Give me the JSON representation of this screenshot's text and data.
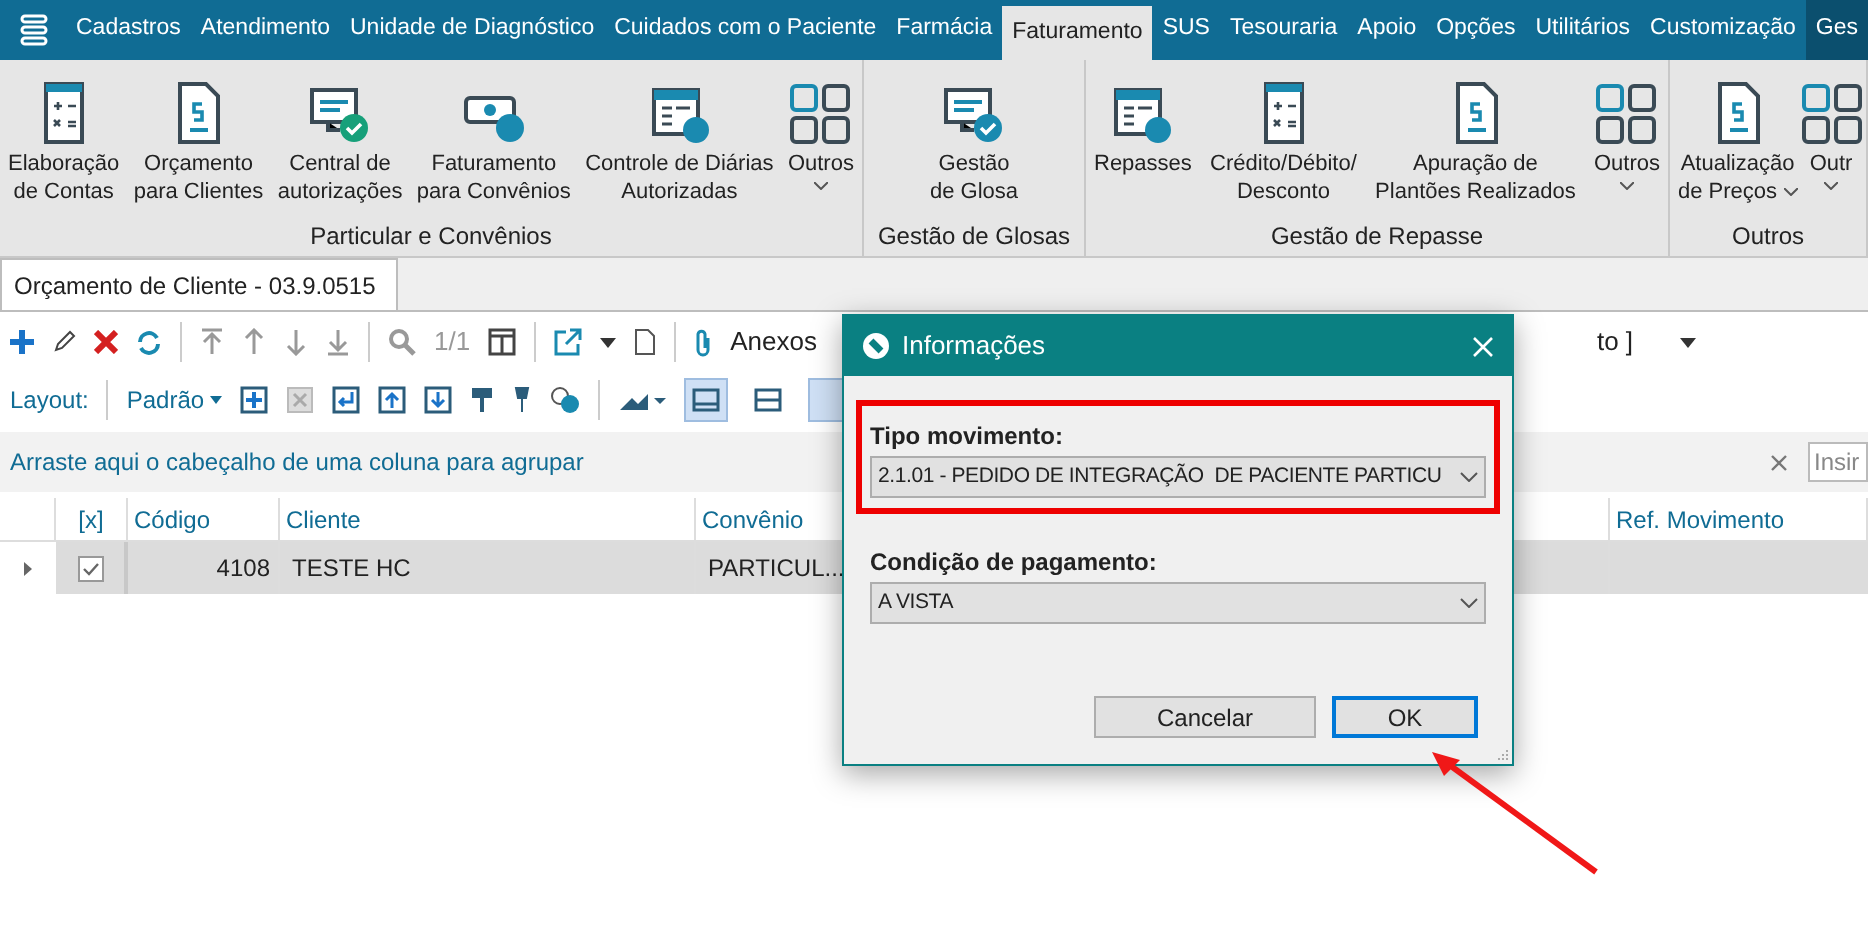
{
  "menu_bar": {
    "items": [
      {
        "label": "Cadastros",
        "selected": false,
        "contextual": false
      },
      {
        "label": "Atendimento",
        "selected": false,
        "contextual": false
      },
      {
        "label": "Unidade de Diagnóstico",
        "selected": false,
        "contextual": false
      },
      {
        "label": "Cuidados com o Paciente",
        "selected": false,
        "contextual": false
      },
      {
        "label": "Farmácia",
        "selected": false,
        "contextual": false
      },
      {
        "label": "Faturamento",
        "selected": true,
        "contextual": false
      },
      {
        "label": "SUS",
        "selected": false,
        "contextual": false
      },
      {
        "label": "Tesouraria",
        "selected": false,
        "contextual": false
      },
      {
        "label": "Apoio",
        "selected": false,
        "contextual": false
      },
      {
        "label": "Opções",
        "selected": false,
        "contextual": false
      },
      {
        "label": "Utilitários",
        "selected": false,
        "contextual": false
      },
      {
        "label": "Customização",
        "selected": false,
        "contextual": false
      },
      {
        "label": "Ges",
        "selected": false,
        "contextual": true
      }
    ]
  },
  "ribbon": {
    "groups": [
      {
        "title": "Particular e Convênios",
        "buttons": [
          {
            "kind": "command",
            "lines": [
              "Elaboração",
              "de Contas"
            ],
            "dropdown": false
          },
          {
            "kind": "command",
            "lines": [
              "Orçamento",
              "para Clientes"
            ],
            "dropdown": false
          },
          {
            "kind": "command",
            "lines": [
              "Central de",
              "autorizações"
            ],
            "dropdown": false
          },
          {
            "kind": "command",
            "lines": [
              "Faturamento",
              "para Convênios"
            ],
            "dropdown": false
          },
          {
            "kind": "command",
            "lines": [
              "Controle de Diárias",
              "Autorizadas"
            ],
            "dropdown": false
          },
          {
            "kind": "more",
            "lines": [
              "Outros"
            ],
            "dropdown": true
          }
        ]
      },
      {
        "title": "Gestão de Glosas",
        "buttons": [
          {
            "kind": "command",
            "lines": [
              "Gestão",
              "de Glosa"
            ],
            "dropdown": false
          }
        ]
      },
      {
        "title": "Gestão de Repasse",
        "buttons": [
          {
            "kind": "command",
            "lines": [
              "Repasses"
            ],
            "dropdown": false
          },
          {
            "kind": "command",
            "lines": [
              "Crédito/Débito/",
              "Desconto"
            ],
            "dropdown": false
          },
          {
            "kind": "command",
            "lines": [
              "Apuração de",
              "Plantões Realizados"
            ],
            "dropdown": false
          },
          {
            "kind": "more",
            "lines": [
              "Outros"
            ],
            "dropdown": true
          }
        ]
      },
      {
        "title": "Outros",
        "buttons": [
          {
            "kind": "command",
            "lines": [
              "Atualização",
              "de Preços"
            ],
            "dropdown": true
          },
          {
            "kind": "more",
            "lines": [
              "Outr"
            ],
            "dropdown": true
          }
        ]
      }
    ]
  },
  "document_tab": {
    "title": "Orçamento de Cliente - 03.9.0515"
  },
  "toolbar": {
    "record_counter": "1/1",
    "attachments": "Anexos",
    "cut_label": "to ]"
  },
  "layout_bar": {
    "label": "Layout:",
    "layout": "Padrão"
  },
  "group_panel": {
    "hint": "Arraste aqui o cabeçalho de uma coluna para agrupar",
    "search_placeholder": "Insir"
  },
  "grid": {
    "columns": [
      "[x]",
      "Código",
      "Cliente",
      "Convênio",
      "Ref. Movimento"
    ],
    "rows": [
      {
        "selected": true,
        "checked": true,
        "codigo": "4108",
        "cliente": "TESTE HC",
        "convenio": "PARTICUL..."
      }
    ]
  },
  "dialog": {
    "title": "Informações",
    "fields": [
      {
        "label": "Tipo movimento:",
        "value": "2.1.01 - PEDIDO DE INTEGRAÇÃO  DE PACIENTE PARTICU",
        "highlighted": true
      },
      {
        "label": "Condição de pagamento:",
        "value": "A VISTA",
        "highlighted": false
      }
    ],
    "buttons": [
      {
        "label": "Cancelar",
        "default": false
      },
      {
        "label": "OK",
        "default": true
      }
    ]
  }
}
